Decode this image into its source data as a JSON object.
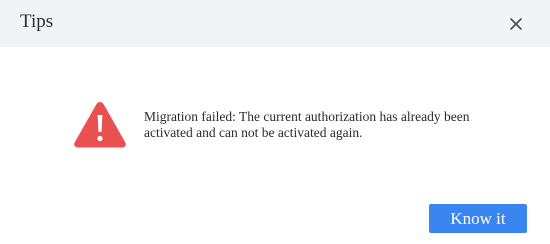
{
  "dialog": {
    "title": "Tips",
    "close_icon": "close-icon",
    "warning_icon": "warning-triangle-icon",
    "message": "Migration failed: The current authorization has already been activated and can not be activated again.",
    "confirm_label": "Know it"
  },
  "colors": {
    "header_bg": "#f2f3f7",
    "warning": "#e8514f",
    "button": "#3a86f0"
  }
}
